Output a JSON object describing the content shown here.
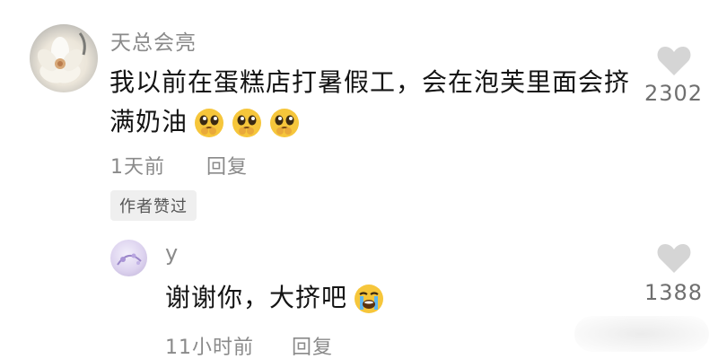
{
  "comments": [
    {
      "username": "天总会亮",
      "text": "我以前在蛋糕店打暑假工，会在泡芙里面会挤满奶油",
      "emojis": [
        "pleading-face-emoji",
        "pleading-face-emoji",
        "pleading-face-emoji"
      ],
      "time": "1天前",
      "reply_label": "回复",
      "badge": "作者赞过",
      "likes": "2302"
    },
    {
      "username": "y",
      "text": "谢谢你，大挤吧",
      "emojis": [
        "crying-face-emoji"
      ],
      "time": "11小时前",
      "reply_label": "回复",
      "likes": "1388"
    }
  ],
  "colors": {
    "username": "#8a8a8a",
    "text": "#141414",
    "meta": "#8a8a8a",
    "like_icon": "#d5d5d5",
    "badge_bg": "#efefef",
    "emoji_yellow": "#f6c63b"
  }
}
